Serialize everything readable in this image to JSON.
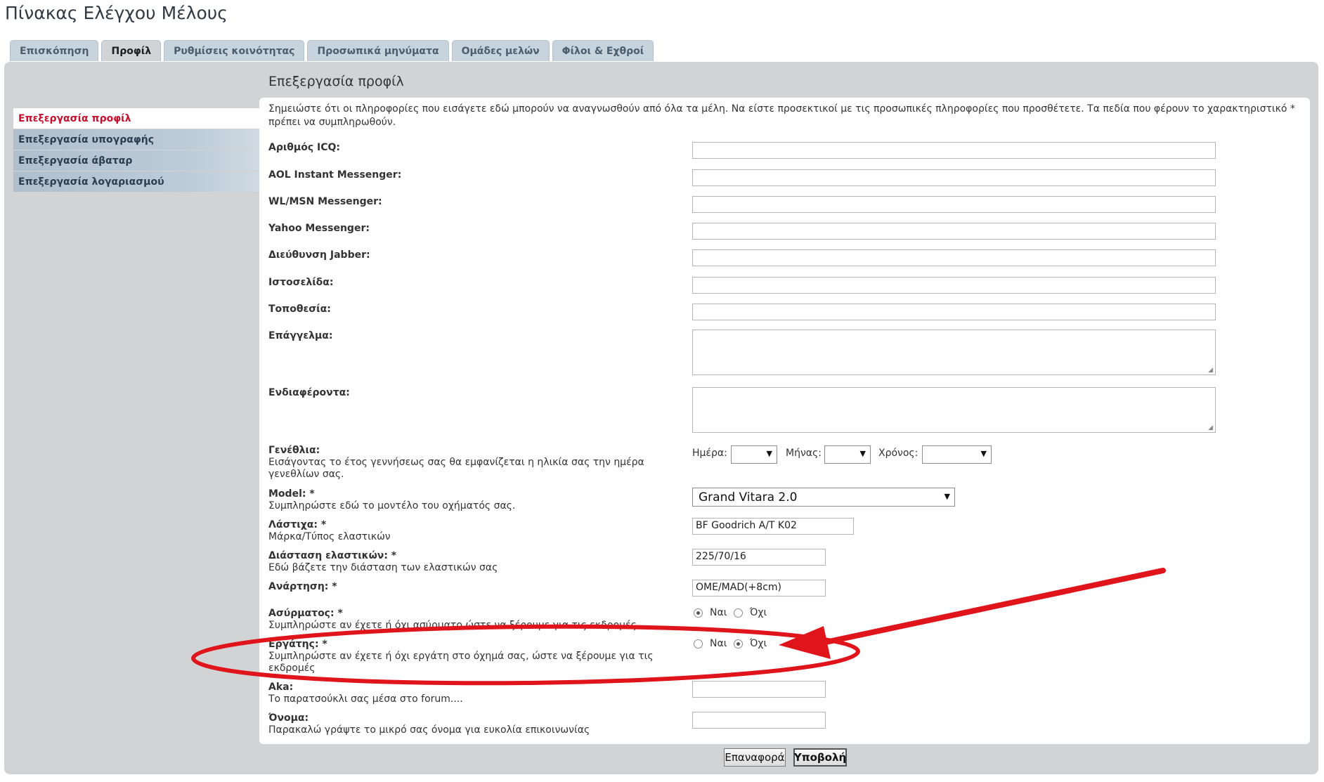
{
  "page_title": "Πίνακας Ελέγχου Μέλους",
  "tabs": [
    "Επισκόπηση",
    "Προφίλ",
    "Ρυθμίσεις κοινότητας",
    "Προσωπικά μηνύματα",
    "Ομάδες μελών",
    "Φίλοι & Εχθροί"
  ],
  "sidebar": [
    "Επεξεργασία προφίλ",
    "Επεξεργασία υπογραφής",
    "Επεξεργασία άβαταρ",
    "Επεξεργασία λογαριασμού"
  ],
  "form": {
    "title": "Επεξεργασία προφίλ",
    "note": "Σημειώστε ότι οι πληροφορίες που εισάγετε εδώ μπορούν να αναγνωσθούν από όλα τα μέλη. Να είστε προσεκτικοί με τις προσωπικές πληροφορίες που προσθέτετε. Τα πεδία που φέρουν το χαρακτηριστικό * πρέπει να συμπληρωθούν.",
    "icq": "Αριθμός ICQ:",
    "aim": "AOL Instant Messenger:",
    "msn": "WL/MSN Messenger:",
    "yahoo": "Yahoo Messenger:",
    "jabber": "Διεύθυνση Jabber:",
    "website": "Ιστοσελίδα:",
    "location": "Τοποθεσία:",
    "occupation": "Επάγγελμα:",
    "interests": "Ενδιαφέροντα:",
    "birthday": {
      "label": "Γενέθλια:",
      "explain": "Εισάγοντας το έτος γεννήσεως σας θα εμφανίζεται η ηλικία σας την ημέρα γενεθλίων σας.",
      "day": "Ημέρα:",
      "month": "Μήνας:",
      "year": "Χρόνος:"
    },
    "model": {
      "label": "Model: *",
      "explain": "Συμπληρώστε εδώ το μοντέλο του οχήματός σας.",
      "value": "Grand Vitara 2.0"
    },
    "tyres": {
      "label": "Λάστιχα: *",
      "explain": "Μάρκα/Τύπος ελαστικών",
      "value": "BF Goodrich A/T K02"
    },
    "tyre_size": {
      "label": "Διάσταση ελαστικών: *",
      "explain": "Εδώ βάζετε την διάσταση των ελαστικών σας",
      "value": "225/70/16"
    },
    "suspension": {
      "label": "Ανάρτηση: *",
      "value": "OME/MAD(+8cm)"
    },
    "wireless": {
      "label": "Ασύρματος: *",
      "explain": "Συμπληρώστε αν έχετε ή όχι ασύρματο ώστε να ξέρουμε για τις εκδρομές",
      "yes": "Ναι",
      "no": "Όχι"
    },
    "winch": {
      "label": "Εργάτης: *",
      "explain": "Συμπληρώστε αν έχετε ή όχι εργάτη στο όχημά σας, ώστε να ξέρουμε για τις εκδρομές",
      "yes": "Ναι",
      "no": "Όχι"
    },
    "aka": {
      "label": "Aka:",
      "explain": "Το παρατσούκλι σας μέσα στο forum...."
    },
    "name": {
      "label": "Όνομα:",
      "explain": "Παρακαλώ γράψτε το μικρό σας όνομα για ευκολία επικοινωνίας"
    },
    "reset": "Επαναφορά",
    "submit": "Υποβολή"
  },
  "colors": {
    "accent_red": "#e0141b",
    "active_link": "#c8102e",
    "panel_bg": "#d2d3d4"
  }
}
